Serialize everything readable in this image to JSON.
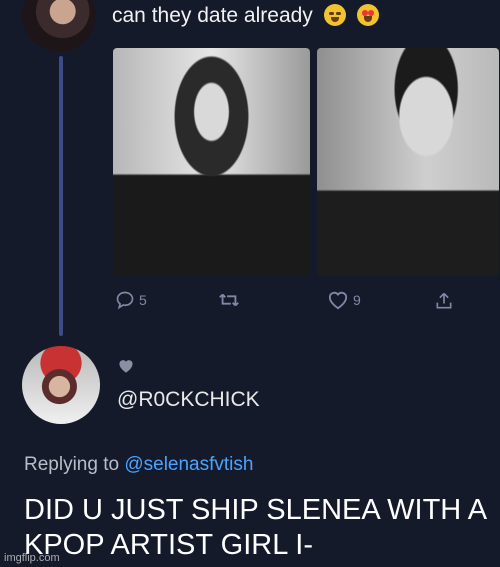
{
  "tweet": {
    "text": "can they date already",
    "emojis": [
      "crying-face-icon",
      "heart-eyes-icon"
    ],
    "actions": {
      "reply_count": "5",
      "like_count": "9"
    }
  },
  "reply": {
    "handle": "@R0CKCHICK",
    "replying_prefix": "Replying to ",
    "replying_to": "@selenasfvtish",
    "body_line1": "DID U JUST SHIP SLENEA WITH A",
    "body_line2": "KPOP ARTIST GIRL I-"
  },
  "watermark": "imgflip.com",
  "colors": {
    "background": "#151a2b",
    "thread_line": "#3e4b8a",
    "mention": "#4aa3ff",
    "icon": "#7f89a6"
  }
}
